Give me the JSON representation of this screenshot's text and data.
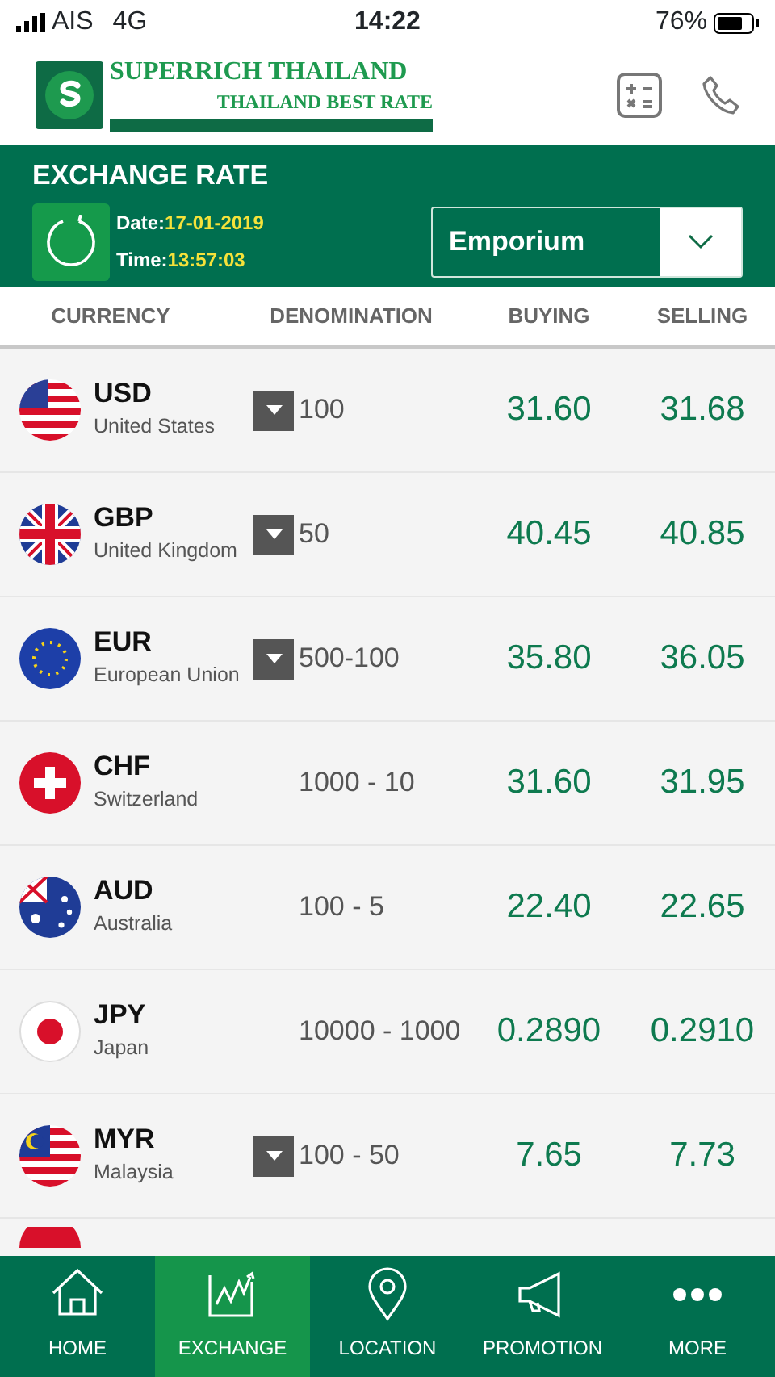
{
  "status_bar": {
    "carrier": "AIS",
    "network": "4G",
    "time": "14:22",
    "battery": "76%"
  },
  "header": {
    "brand": "SUPERRICH THAILAND",
    "tagline": "THAILAND BEST RATE"
  },
  "rate_panel": {
    "title": "EXCHANGE RATE",
    "date_label": "Date:",
    "date": "17-01-2019",
    "time_label": "Time:",
    "time": "13:57:03",
    "branch": "Emporium"
  },
  "table": {
    "columns": [
      "CURRENCY",
      "DENOMINATION",
      "BUYING",
      "SELLING"
    ],
    "rows": [
      {
        "code": "USD",
        "country": "United States",
        "dropdown": true,
        "denomination": "100",
        "buying": "31.60",
        "selling": "31.68"
      },
      {
        "code": "GBP",
        "country": "United Kingdom",
        "dropdown": true,
        "denomination": "50",
        "buying": "40.45",
        "selling": "40.85"
      },
      {
        "code": "EUR",
        "country": "European Union",
        "dropdown": true,
        "denomination": "500-100",
        "buying": "35.80",
        "selling": "36.05"
      },
      {
        "code": "CHF",
        "country": "Switzerland",
        "dropdown": false,
        "denomination": "1000 - 10",
        "buying": "31.60",
        "selling": "31.95"
      },
      {
        "code": "AUD",
        "country": "Australia",
        "dropdown": false,
        "denomination": "100 - 5",
        "buying": "22.40",
        "selling": "22.65"
      },
      {
        "code": "JPY",
        "country": "Japan",
        "dropdown": false,
        "denomination": "10000 - 1000",
        "buying": "0.2890",
        "selling": "0.2910"
      },
      {
        "code": "MYR",
        "country": "Malaysia",
        "dropdown": true,
        "denomination": "100 - 50",
        "buying": "7.65",
        "selling": "7.73"
      }
    ]
  },
  "tab_bar": [
    {
      "label": "HOME",
      "selected": false
    },
    {
      "label": "EXCHANGE",
      "selected": true
    },
    {
      "label": "LOCATION",
      "selected": false
    },
    {
      "label": "PROMOTION",
      "selected": false
    },
    {
      "label": "MORE",
      "selected": false
    }
  ]
}
